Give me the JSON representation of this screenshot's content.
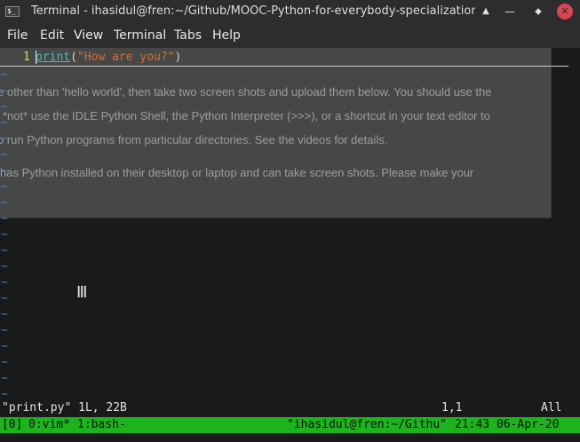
{
  "window": {
    "title": "Terminal - ihasidul@fren:~/Github/MOOC-Python-for-everybody-specialization/Us",
    "app_icon": "$_",
    "buttons": {
      "keep_above_icon": "caret-up-icon",
      "minimize_icon": "minimize-icon",
      "restore_icon": "restore-icon",
      "close_icon": "close-icon"
    }
  },
  "menu": {
    "items": [
      "File",
      "Edit",
      "View",
      "Terminal",
      "Tabs",
      "Help"
    ]
  },
  "editor": {
    "line_number": "1",
    "code": {
      "func": "print",
      "paren_open": "(",
      "string": "\"How are you?\"",
      "paren_close": ")"
    },
    "tilde": "~",
    "message": "\"print.py\" 1L, 22B",
    "cursor_position": "1,1",
    "scroll_position": "All"
  },
  "background_page": {
    "lines": [
      "e other than 'hello world', then take two screen shots and upload them below. You should use the",
      "*not* use the IDLE Python Shell, the Python Interpreter (>>>), or a shortcut in your text editor to",
      "o run Python programs from particular directories. See the videos for details.",
      "has Python installed on their desktop or laptop and can take screen shots. Please make your"
    ]
  },
  "tmux": {
    "session": "[0]",
    "window_0": "0:vim*",
    "window_1": "1:bash-",
    "host": "\"ihasidul@fren:~/Githu\"",
    "clock": "21:43 06-",
    "clock_tail": "Apr-20"
  },
  "colors": {
    "terminal_bg": "#1a1a1a",
    "status_bar": "#1db31d",
    "line_number": "#e6d34a",
    "function": "#4eb6b7",
    "string": "#d1702f",
    "tilde": "#4a7bbb",
    "close_button": "#da4453"
  }
}
